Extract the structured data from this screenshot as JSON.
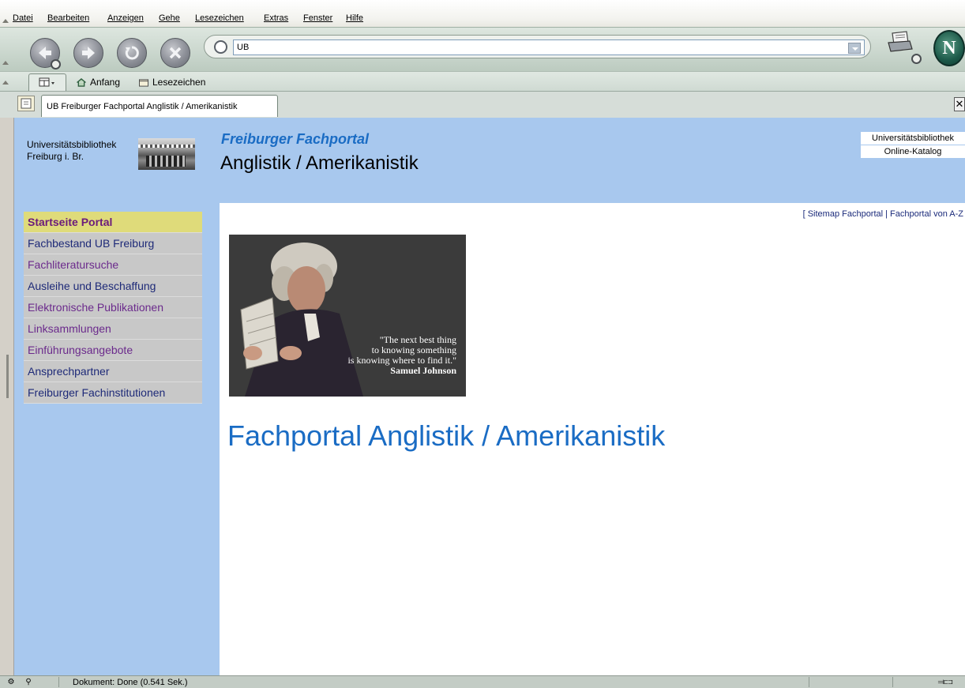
{
  "menubar": {
    "items": [
      "Datei",
      "Bearbeiten",
      "Anzeigen",
      "Gehe",
      "Lesezeichen",
      "Extras",
      "Fenster",
      "Hilfe"
    ]
  },
  "navbar": {
    "url": "UB"
  },
  "personal_toolbar": {
    "home_label": "Anfang",
    "bookmarks_label": "Lesezeichen"
  },
  "tab": {
    "title": "UB Freiburger Fachportal Anglistik / Amerikanistik"
  },
  "header": {
    "library_line1": "Universitätsbibliothek",
    "library_line2": "Freiburg i. Br.",
    "portal_subtitle": "Freiburger Fachportal",
    "portal_title": "Anglistik / Amerikanistik",
    "links": [
      "Universitätsbibliothek",
      "Online-Katalog"
    ]
  },
  "leftnav": {
    "items": [
      {
        "label": "Startseite Portal",
        "state": "active"
      },
      {
        "label": "Fachbestand UB Freiburg",
        "state": "navy"
      },
      {
        "label": "Fachliteratursuche",
        "state": "purple"
      },
      {
        "label": "Ausleihe und Beschaffung",
        "state": "navy"
      },
      {
        "label": "Elektronische Publikationen",
        "state": "purple"
      },
      {
        "label": "Linksammlungen",
        "state": "purple"
      },
      {
        "label": "Einführungsangebote",
        "state": "purple"
      },
      {
        "label": "Ansprechpartner",
        "state": "navy"
      },
      {
        "label": "Freiburger Fachinstitutionen",
        "state": "navy"
      }
    ]
  },
  "content": {
    "sitemap_text": "[ Sitemap Fachportal | Fachportal von A-Z",
    "quote_lines": [
      "\"The next best thing",
      "to knowing something",
      "is knowing where to find it.\""
    ],
    "quote_author": "Samuel Johnson",
    "heading": "Fachportal Anglistik / Amerikanistik"
  },
  "status": {
    "text": "Dokument: Done (0.541 Sek.)"
  },
  "colors": {
    "header_bg": "#a8c8ee",
    "accent_blue": "#1a6cc4",
    "nav_active_bg": "#dfdb7a",
    "nav_bg": "#c8c8c8"
  }
}
